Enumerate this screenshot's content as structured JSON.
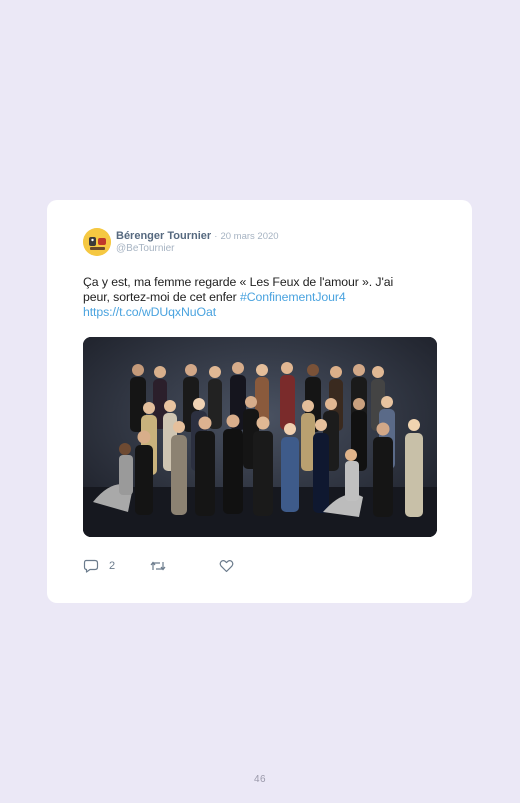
{
  "tweet": {
    "author_name": "Bérenger Tournier",
    "separator": "·",
    "date": "20 mars 2020",
    "handle": "@BeTournier",
    "text_line1": "Ça y est, ma femme regarde « Les Feux de l'amour ». J'ai",
    "text_line2": "peur, sortez-moi de cet enfer",
    "hashtag": "#ConfinementJour4",
    "link": "https://t.co/wDUqxNuOat",
    "reply_count": "2"
  },
  "page": {
    "number": "46"
  },
  "colors": {
    "background": "#ebe8f6",
    "card": "#ffffff",
    "link": "#4aa3df",
    "muted": "#a6b3c2",
    "name": "#56697f"
  },
  "icons": [
    "reply-icon",
    "retweet-icon",
    "like-icon"
  ]
}
